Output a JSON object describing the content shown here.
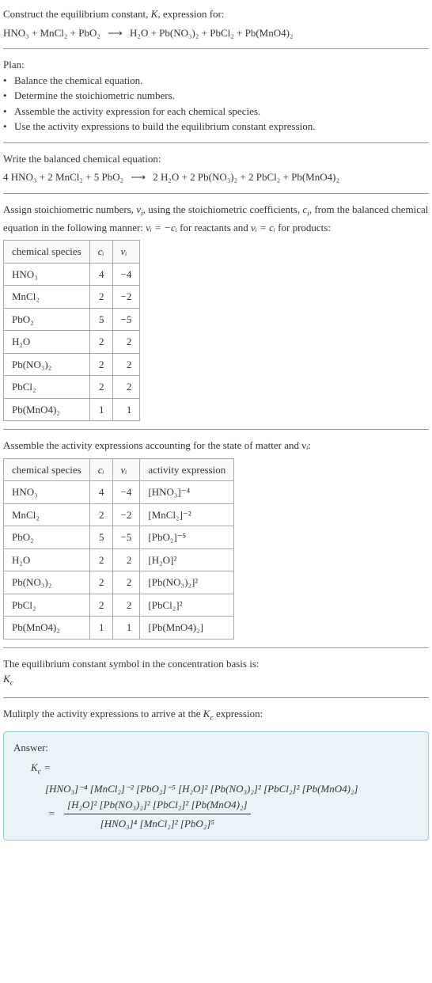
{
  "intro": {
    "line1": "Construct the equilibrium constant, ",
    "Kvar": "K",
    "line1b": ", expression for:",
    "equation_lhs": "HNO₃ + MnCl₂ + PbO₂",
    "arrow": "⟶",
    "equation_rhs": "H₂O + Pb(NO₃)₂ + PbCl₂ + Pb(MnO4)₂"
  },
  "plan": {
    "title": "Plan:",
    "items": [
      "Balance the chemical equation.",
      "Determine the stoichiometric numbers.",
      "Assemble the activity expression for each chemical species.",
      "Use the activity expressions to build the equilibrium constant expression."
    ]
  },
  "balanced": {
    "title": "Write the balanced chemical equation:",
    "lhs": "4 HNO₃ + 2 MnCl₂ + 5 PbO₂",
    "arrow": "⟶",
    "rhs": "2 H₂O + 2 Pb(NO₃)₂ + 2 PbCl₂ + Pb(MnO4)₂"
  },
  "stoich_assign": {
    "text_a": "Assign stoichiometric numbers, ",
    "nu": "ν",
    "sub_i": "i",
    "text_b": ", using the stoichiometric coefficients, ",
    "c": "c",
    "text_c": ", from the balanced chemical equation in the following manner: ",
    "rel1": "νᵢ = −cᵢ",
    "text_d": " for reactants and ",
    "rel2": "νᵢ = cᵢ",
    "text_e": " for products:"
  },
  "stoich_table": {
    "headers": [
      "chemical species",
      "cᵢ",
      "νᵢ"
    ],
    "rows": [
      {
        "species": "HNO₃",
        "c": "4",
        "nu": "−4"
      },
      {
        "species": "MnCl₂",
        "c": "2",
        "nu": "−2"
      },
      {
        "species": "PbO₂",
        "c": "5",
        "nu": "−5"
      },
      {
        "species": "H₂O",
        "c": "2",
        "nu": "2"
      },
      {
        "species": "Pb(NO₃)₂",
        "c": "2",
        "nu": "2"
      },
      {
        "species": "PbCl₂",
        "c": "2",
        "nu": "2"
      },
      {
        "species": "Pb(MnO4)₂",
        "c": "1",
        "nu": "1"
      }
    ]
  },
  "activity_intro": "Assemble the activity expressions accounting for the state of matter and νᵢ:",
  "activity_table": {
    "headers": [
      "chemical species",
      "cᵢ",
      "νᵢ",
      "activity expression"
    ],
    "rows": [
      {
        "species": "HNO₃",
        "c": "4",
        "nu": "−4",
        "act": "[HNO₃]⁻⁴"
      },
      {
        "species": "MnCl₂",
        "c": "2",
        "nu": "−2",
        "act": "[MnCl₂]⁻²"
      },
      {
        "species": "PbO₂",
        "c": "5",
        "nu": "−5",
        "act": "[PbO₂]⁻⁵"
      },
      {
        "species": "H₂O",
        "c": "2",
        "nu": "2",
        "act": "[H₂O]²"
      },
      {
        "species": "Pb(NO₃)₂",
        "c": "2",
        "nu": "2",
        "act": "[Pb(NO₃)₂]²"
      },
      {
        "species": "PbCl₂",
        "c": "2",
        "nu": "2",
        "act": "[PbCl₂]²"
      },
      {
        "species": "Pb(MnO4)₂",
        "c": "1",
        "nu": "1",
        "act": "[Pb(MnO4)₂]"
      }
    ]
  },
  "eq_const": {
    "line1": "The equilibrium constant symbol in the concentration basis is:",
    "kc": "K",
    "kc_sub": "c"
  },
  "multiply": {
    "text_a": "Mulitply the activity expressions to arrive at the ",
    "kc": "K",
    "kc_sub": "c",
    "text_b": " expression:"
  },
  "answer": {
    "label": "Answer:",
    "kc": "K",
    "kc_sub": "c",
    "equals": " =",
    "expr_flat": "[HNO₃]⁻⁴ [MnCl₂]⁻² [PbO₂]⁻⁵ [H₂O]² [Pb(NO₃)₂]² [PbCl₂]² [Pb(MnO4)₂]",
    "expr_num": "[H₂O]² [Pb(NO₃)₂]² [PbCl₂]² [Pb(MnO4)₂]",
    "expr_den": "[HNO₃]⁴ [MnCl₂]² [PbO₂]⁵",
    "eq2": "="
  }
}
